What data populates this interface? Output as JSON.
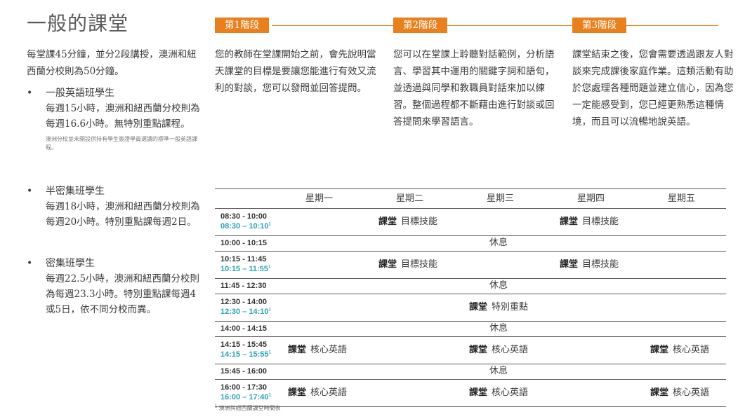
{
  "title": "一般的課堂",
  "intro": "每堂課45分鐘，並分2段講授，澳洲和紐西蘭分校則為50分鐘。",
  "levels": [
    {
      "name": "一般英語班學生",
      "desc": "每週15小時，澳洲和紐西蘭分校則為每週16.6小時。無特別重點課程。",
      "note": "澳洲分校並未開設供持有學生簽證學員選讀的標準一般英語課程。"
    },
    {
      "name": "半密集班學生",
      "desc": "每週18小時，澳洲和紐西蘭分校則為每週20小時。特別重點課每週2日。"
    },
    {
      "name": "密集班學生",
      "desc": "每週22.5小時，澳洲和紐西蘭分校則為每週23.3小時。特別重點課每週4或5日，依不同分校而異。"
    }
  ],
  "stages": [
    {
      "label": "第1階段",
      "text": "您的教師在堂課開始之前，會先說明當天課堂的目標是要讓您能進行有效又流利的對談，您可以發問並回答提問。"
    },
    {
      "label": "第2階段",
      "text": "您可以在堂課上聆聽對話範例，分析語言、學習其中運用的關鍵字詞和語句，並透過與同學和教職員對話來加以練習。整個過程都不斷藉由進行對談或回答提問來學習語言。"
    },
    {
      "label": "第3階段",
      "text": "課堂結束之後，您會需要透過跟友人對談來完成課後家庭作業。這類活動有助於您處理各種問題並建立信心，因為您一定能感受到，您已經更熟悉這種情境，而且可以流暢地說英語。"
    }
  ],
  "timetable": {
    "days": [
      "星期一",
      "星期二",
      "星期三",
      "星期四",
      "星期五"
    ],
    "class_word": "課堂",
    "break_word": "休息",
    "rows": [
      {
        "time": "08:30 - 10:00",
        "time_nz": "08:30 – 10:10",
        "c1": "目標技能",
        "c2": "目標技能"
      },
      {
        "time": "10:00 - 10:15"
      },
      {
        "time": "10:15 - 11:45",
        "time_nz": "10:15 – 11:55",
        "c1": "目標技能",
        "c2": "目標技能"
      },
      {
        "time": "11:45 - 12:30"
      },
      {
        "time": "12:30 - 14:00",
        "time_nz": "12:30 – 14:10",
        "c1": "特別重點"
      },
      {
        "time": "14:00 - 14:15"
      },
      {
        "time": "14:15 - 15:45",
        "time_nz": "14:15 – 15:55",
        "c1": "核心英語",
        "c2": "核心英語",
        "c3": "核心英語"
      },
      {
        "time": "15:45 - 16:00"
      },
      {
        "time": "16:00 - 17:30",
        "time_nz": "16:00 – 17:40",
        "c1": "核心英語",
        "c2": "核心英語",
        "c3": "核心英語"
      }
    ],
    "sup_mark": "1",
    "footnote": "澳洲與紐西蘭課堂時間表"
  }
}
